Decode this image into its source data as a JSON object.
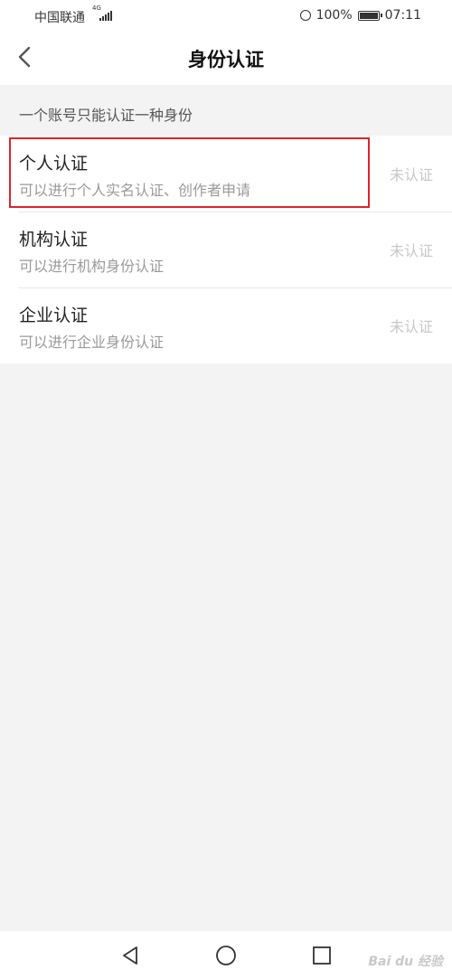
{
  "status_bar": {
    "carrier": "中国联通",
    "network": "4G",
    "battery": "100%",
    "time": "07:11"
  },
  "header": {
    "title": "身份认证"
  },
  "hint": "一个账号只能认证一种身份",
  "items": [
    {
      "title": "个人认证",
      "description": "可以进行个人实名认证、创作者申请",
      "status": "未认证"
    },
    {
      "title": "机构认证",
      "description": "可以进行机构身份认证",
      "status": "未认证"
    },
    {
      "title": "企业认证",
      "description": "可以进行企业身份认证",
      "status": "未认证"
    }
  ],
  "watermark": "Bai du 经验",
  "colors": {
    "highlight": "#d9262b",
    "background": "#f3f3f3",
    "status_text": "#c7c7c7"
  },
  "icons": [
    "back-arrow-icon",
    "alarm-icon",
    "battery-icon",
    "signal-icon",
    "nav-back-icon",
    "nav-home-icon",
    "nav-recent-icon"
  ]
}
